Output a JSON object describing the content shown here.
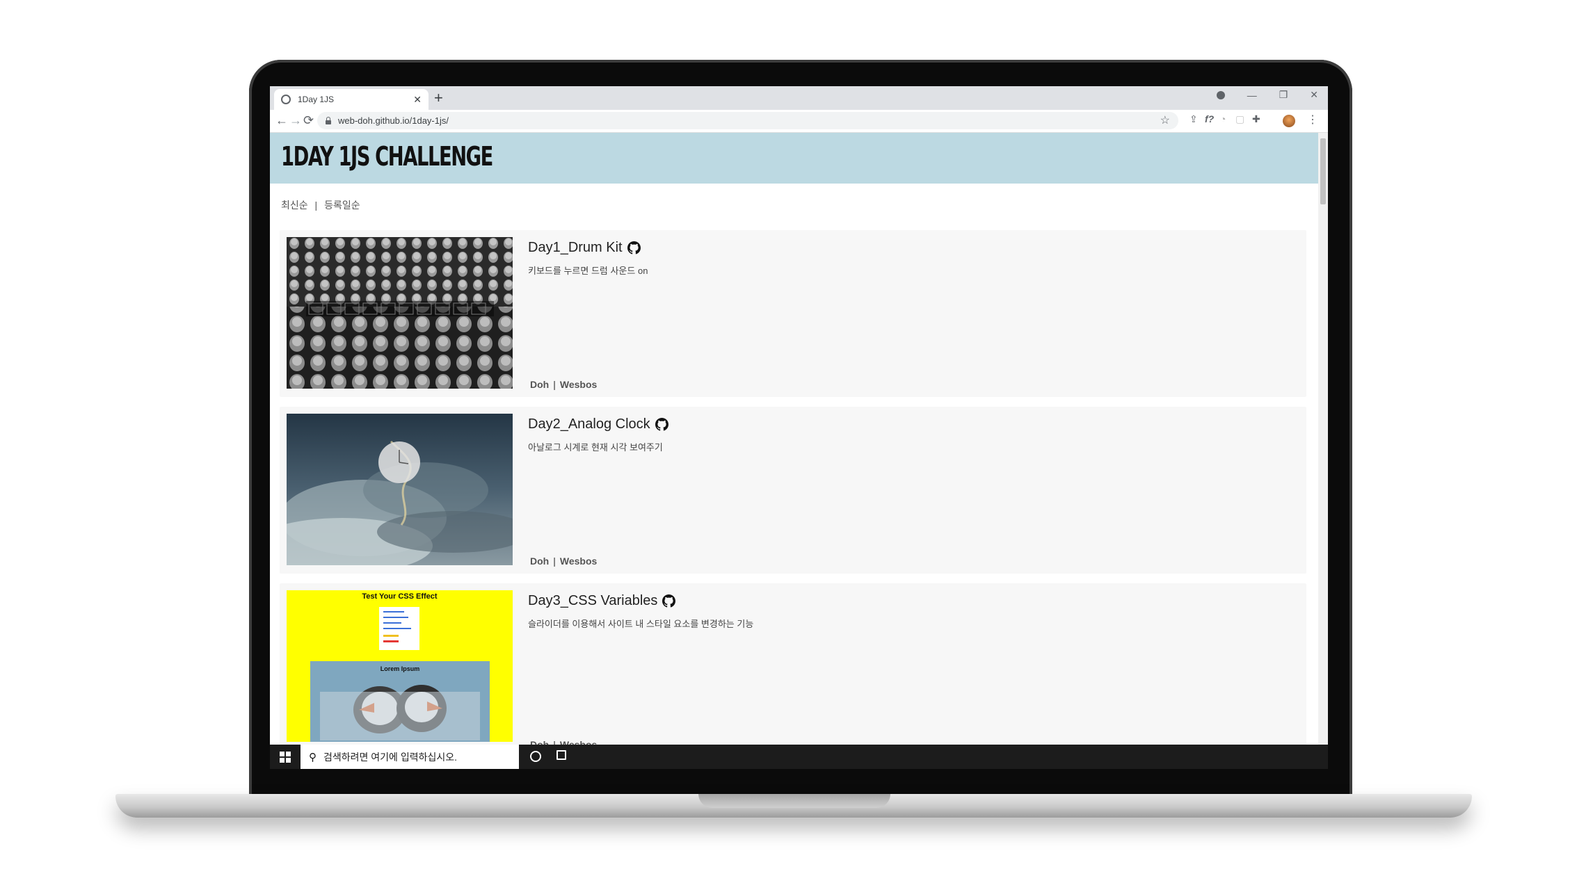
{
  "browser": {
    "tab_title": "1Day 1JS",
    "tab_close": "✕",
    "new_tab": "+",
    "url": "web-doh.github.io/1day-1js/",
    "nav": {
      "back": "←",
      "forward": "→",
      "reload": "⟳"
    },
    "window_controls": {
      "minimize": "—",
      "restore": "❐",
      "close": "✕"
    }
  },
  "site": {
    "title": "1DAY 1JS CHALLENGE",
    "sort": {
      "latest": "최신순",
      "separator": "|",
      "registered": "등록일순"
    }
  },
  "cards": [
    {
      "title": "Day1_Drum Kit",
      "description": "키보드를 누르면 드럼 사운드 on",
      "author": "Doh",
      "separator": "|",
      "source": "Wesbos"
    },
    {
      "title": "Day2_Analog Clock",
      "description": "아날로그 시계로 현재 시각 보여주기",
      "author": "Doh",
      "separator": "|",
      "source": "Wesbos"
    },
    {
      "title": "Day3_CSS Variables",
      "description": "슬라이더를 이용해서 사이트 내 스타일 요소를 변경하는 기능",
      "author": "Doh",
      "separator": "|",
      "source": "Wesbos",
      "thumb_heading": "Test Your CSS Effect",
      "thumb_sub": "Lorem Ipsum"
    }
  ],
  "taskbar": {
    "search_placeholder": "검색하려면 여기에 입력하십시오."
  },
  "colors": {
    "header_bg": "#bcd9e2",
    "card_bg": "#f7f7f7",
    "day3_thumb_bg": "#ffff00",
    "taskbar_bg": "#1c1c1c"
  }
}
